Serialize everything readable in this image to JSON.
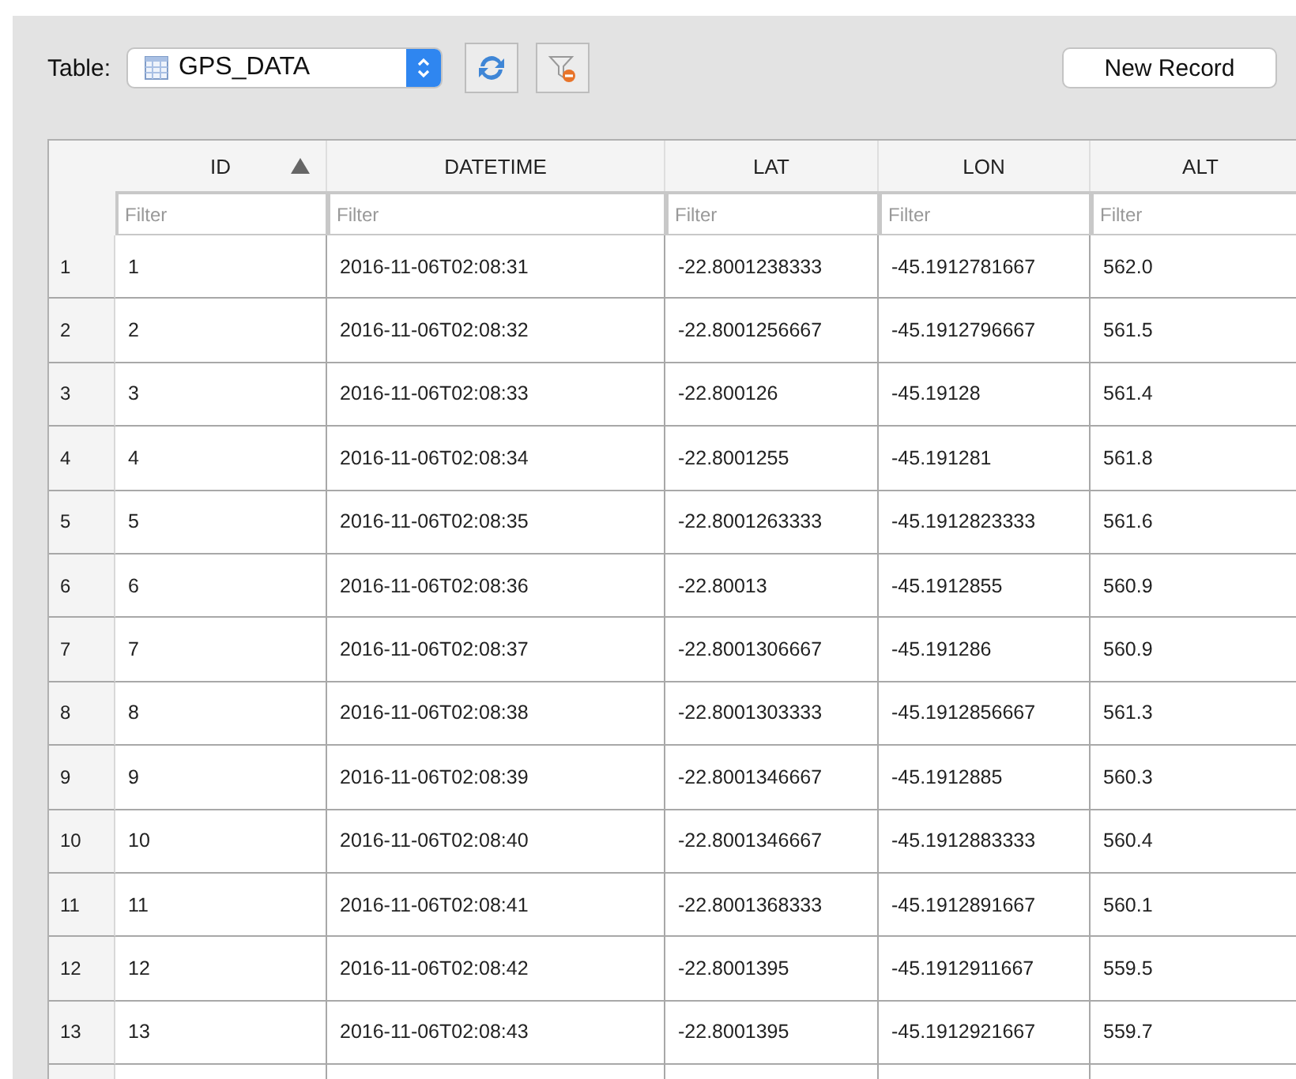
{
  "toolbar": {
    "label": "Table:",
    "table_select": {
      "value": "GPS_DATA"
    },
    "new_record_button": "New Record"
  },
  "table": {
    "columns": [
      {
        "label": "ID",
        "sorted": true,
        "filter_placeholder": "Filter"
      },
      {
        "label": "DATETIME",
        "sorted": false,
        "filter_placeholder": "Filter"
      },
      {
        "label": "LAT",
        "sorted": false,
        "filter_placeholder": "Filter"
      },
      {
        "label": "LON",
        "sorted": false,
        "filter_placeholder": "Filter"
      },
      {
        "label": "ALT",
        "sorted": false,
        "filter_placeholder": "Filter"
      }
    ],
    "rows": [
      {
        "number": "1",
        "cells": [
          "1",
          "2016-11-06T02:08:31",
          "-22.8001238333",
          "-45.1912781667",
          "562.0"
        ]
      },
      {
        "number": "2",
        "cells": [
          "2",
          "2016-11-06T02:08:32",
          "-22.8001256667",
          "-45.1912796667",
          "561.5"
        ]
      },
      {
        "number": "3",
        "cells": [
          "3",
          "2016-11-06T02:08:33",
          "-22.800126",
          "-45.19128",
          "561.4"
        ]
      },
      {
        "number": "4",
        "cells": [
          "4",
          "2016-11-06T02:08:34",
          "-22.8001255",
          "-45.191281",
          "561.8"
        ]
      },
      {
        "number": "5",
        "cells": [
          "5",
          "2016-11-06T02:08:35",
          "-22.8001263333",
          "-45.1912823333",
          "561.6"
        ]
      },
      {
        "number": "6",
        "cells": [
          "6",
          "2016-11-06T02:08:36",
          "-22.80013",
          "-45.1912855",
          "560.9"
        ]
      },
      {
        "number": "7",
        "cells": [
          "7",
          "2016-11-06T02:08:37",
          "-22.8001306667",
          "-45.191286",
          "560.9"
        ]
      },
      {
        "number": "8",
        "cells": [
          "8",
          "2016-11-06T02:08:38",
          "-22.8001303333",
          "-45.1912856667",
          "561.3"
        ]
      },
      {
        "number": "9",
        "cells": [
          "9",
          "2016-11-06T02:08:39",
          "-22.8001346667",
          "-45.1912885",
          "560.3"
        ]
      },
      {
        "number": "10",
        "cells": [
          "10",
          "2016-11-06T02:08:40",
          "-22.8001346667",
          "-45.1912883333",
          "560.4"
        ]
      },
      {
        "number": "11",
        "cells": [
          "11",
          "2016-11-06T02:08:41",
          "-22.8001368333",
          "-45.1912891667",
          "560.1"
        ]
      },
      {
        "number": "12",
        "cells": [
          "12",
          "2016-11-06T02:08:42",
          "-22.8001395",
          "-45.1912911667",
          "559.5"
        ]
      },
      {
        "number": "13",
        "cells": [
          "13",
          "2016-11-06T02:08:43",
          "-22.8001395",
          "-45.1912921667",
          "559.7"
        ]
      }
    ]
  }
}
